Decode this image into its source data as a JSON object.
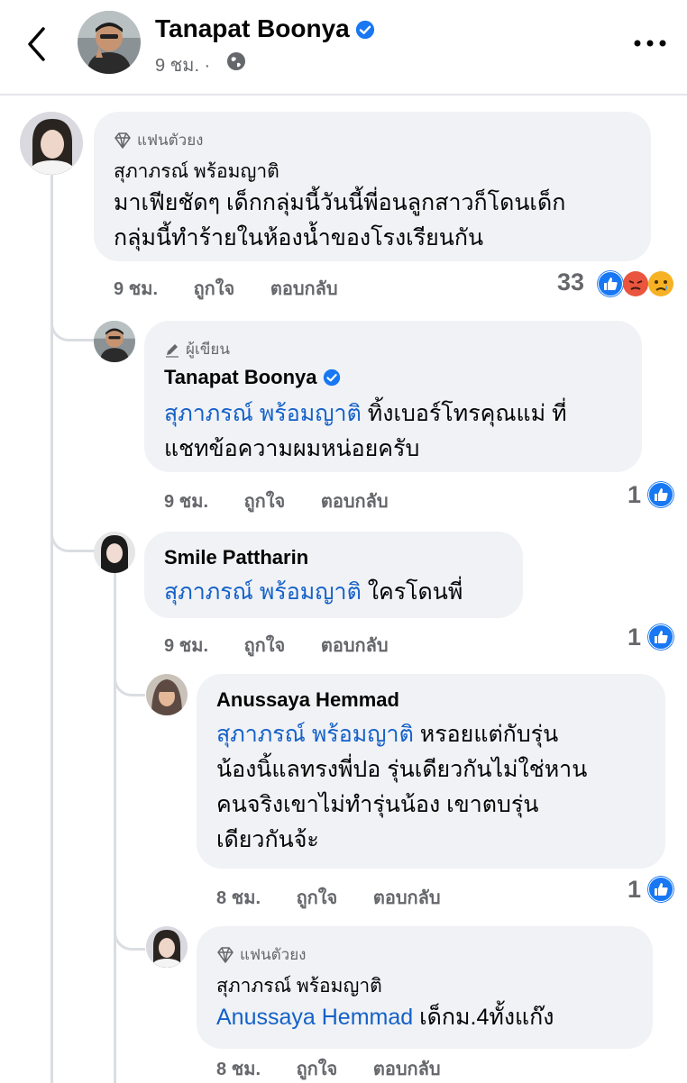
{
  "header": {
    "author": "Tanapat Boonya",
    "time": "9 ชม. ·"
  },
  "comments": [
    {
      "badge": "แฟนตัวยง",
      "author": "สุภาภรณ์ พร้อมญาติ",
      "line1": "มาเฟียชัดๆ เด็กกลุ่มนี้วันนี้พี่อนลูกสาวก็โดนเด็ก",
      "line2": "กลุ่มนี้ทำร้ายในห้องน้ำของโรงเรียนกัน",
      "time": "9 ชม.",
      "like": "ถูกใจ",
      "reply": "ตอบกลับ",
      "count": "33",
      "reactions": [
        "like-icon",
        "angry-icon",
        "sad-icon"
      ]
    },
    {
      "badge": "ผู้เขียน",
      "author": "Tanapat Boonya",
      "mention": "สุภาภรณ์ พร้อมญาติ",
      "rest1": " ทิ้งเบอร์โทรคุณแม่ ที่",
      "line2": "แชทข้อความผมหน่อยครับ",
      "time": "9 ชม.",
      "like": "ถูกใจ",
      "reply": "ตอบกลับ",
      "count": "1",
      "reactions": [
        "like-icon"
      ]
    },
    {
      "author": "Smile Pattharin",
      "mention": "สุภาภรณ์ พร้อมญาติ",
      "rest1": " ใครโดนพี่",
      "time": "9 ชม.",
      "like": "ถูกใจ",
      "reply": "ตอบกลับ",
      "count": "1",
      "reactions": [
        "like-icon"
      ]
    },
    {
      "author": "Anussaya Hemmad",
      "mention": "สุภาภรณ์ พร้อมญาติ",
      "rest1": " หรอยแต่กับรุ่น",
      "line2": "น้องนิ้แลทรงพี่ปอ  รุ่นเดียวกันไม่ใช่หาน",
      "line3": "คนจริงเขาไม่ทำรุ่นน้อง  เขาตบรุ่น",
      "line4": "เดียวกันจ้ะ",
      "time": "8 ชม.",
      "like": "ถูกใจ",
      "reply": "ตอบกลับ",
      "count": "1",
      "reactions": [
        "like-icon"
      ]
    },
    {
      "badge": "แฟนตัวยง",
      "author": "สุภาภรณ์ พร้อมญาติ",
      "mention": "Anussaya Hemmad",
      "rest1": " เด็กม.4ทั้งแก๊ง",
      "time": "8 ชม.",
      "like": "ถูกใจ",
      "reply": "ตอบกลับ"
    }
  ],
  "colors": {
    "mention": "#1461c8",
    "bubble": "#f0f2f5",
    "meta": "#65676b",
    "like_blue": "#1877f2",
    "angry_red": "#e9553f",
    "sad_yellow": "#f7b125"
  }
}
